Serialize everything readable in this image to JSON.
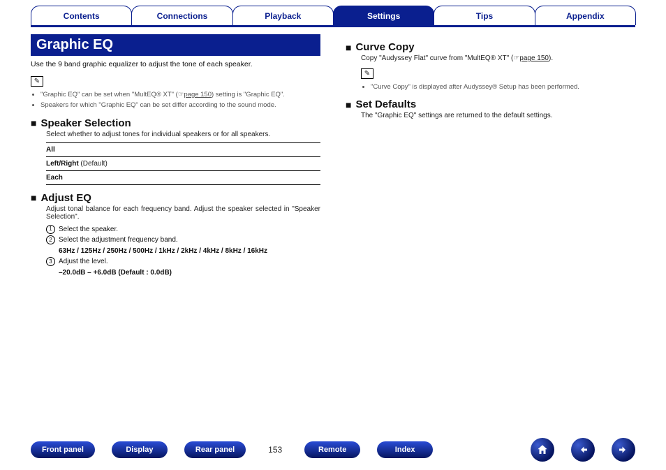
{
  "tabs": {
    "contents": "Contents",
    "connections": "Connections",
    "playback": "Playback",
    "settings": "Settings",
    "tips": "Tips",
    "appendix": "Appendix",
    "active": "settings"
  },
  "title": "Graphic EQ",
  "intro": "Use the 9 band graphic equalizer to adjust the tone of each speaker.",
  "notes": [
    {
      "pre": "\"Graphic EQ\" can be set when \"MultEQ® XT\" (",
      "link": "page 150",
      "post": ") setting is \"Graphic EQ\"."
    },
    {
      "pre": "Speakers for which \"Graphic EQ\" can be set differ according to the sound mode.",
      "link": "",
      "post": ""
    }
  ],
  "speaker_selection": {
    "heading": "Speaker Selection",
    "desc": "Select whether to adjust tones for individual speakers or for all speakers.",
    "options": [
      {
        "label": "All",
        "default": ""
      },
      {
        "label": "Left/Right",
        "default": " (Default)"
      },
      {
        "label": "Each",
        "default": ""
      }
    ]
  },
  "adjust_eq": {
    "heading": "Adjust EQ",
    "desc": "Adjust tonal balance for each frequency band. Adjust the speaker selected in \"Speaker Selection\".",
    "steps": [
      {
        "n": "1",
        "text": "Select the speaker.",
        "emph": ""
      },
      {
        "n": "2",
        "text": "Select the adjustment frequency band.",
        "emph": "63Hz / 125Hz / 250Hz / 500Hz / 1kHz / 2kHz / 4kHz / 8kHz / 16kHz"
      },
      {
        "n": "3",
        "text": "Adjust the level.",
        "emph": "–20.0dB – +6.0dB (Default : 0.0dB)"
      }
    ]
  },
  "curve_copy": {
    "heading": "Curve Copy",
    "desc_pre": "Copy \"Audyssey Flat\" curve from \"MultEQ® XT\" (",
    "desc_link": "page 150",
    "desc_post": ").",
    "note": "\"Curve Copy\" is displayed after Audyssey® Setup has been performed."
  },
  "set_defaults": {
    "heading": "Set Defaults",
    "desc": "The \"Graphic EQ\" settings are returned to the default settings."
  },
  "footer": {
    "front_panel": "Front panel",
    "display": "Display",
    "rear_panel": "Rear panel",
    "page": "153",
    "remote": "Remote",
    "index": "Index"
  }
}
